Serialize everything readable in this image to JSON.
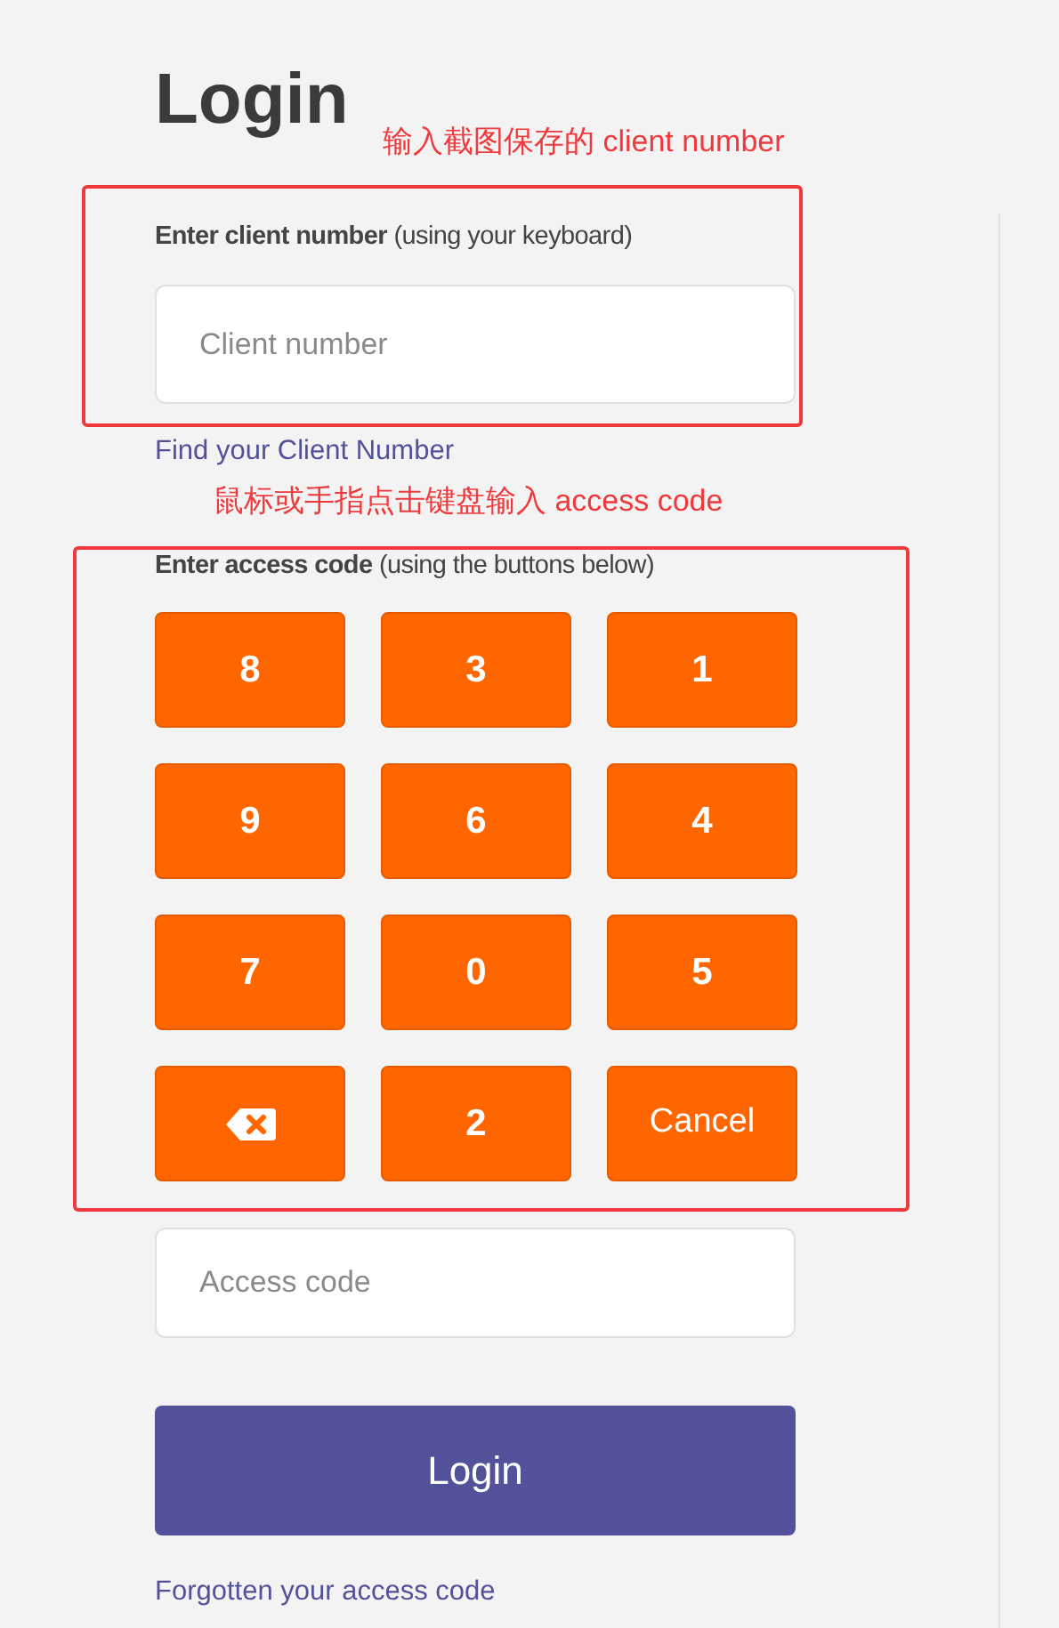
{
  "title": "Login",
  "notes": [
    {
      "text": "输入截图保存的 client number"
    },
    {
      "text": "鼠标或手指点击键盘输入 access code"
    }
  ],
  "client_number": {
    "highlighted": true,
    "label": "**Enter client number** (using your keyboard)",
    "placeholder": "Client number",
    "link": "Find your Client Number"
  },
  "access_code": {
    "highlighted": true,
    "label": "**Enter access code** (using the buttons below)",
    "keys": [
      {
        "kind": "digit",
        "label": "8"
      },
      {
        "kind": "digit",
        "label": "3"
      },
      {
        "kind": "digit",
        "label": "1"
      },
      {
        "kind": "digit",
        "label": "9"
      },
      {
        "kind": "digit",
        "label": "6"
      },
      {
        "kind": "digit",
        "label": "4"
      },
      {
        "kind": "digit",
        "label": "7"
      },
      {
        "kind": "digit",
        "label": "0"
      },
      {
        "kind": "digit",
        "label": "5"
      },
      {
        "kind": "backspace"
      },
      {
        "kind": "digit",
        "label": "2"
      },
      {
        "kind": "text",
        "label": "Cancel"
      }
    ],
    "placeholder": "Access code"
  },
  "login_button": "Login",
  "forgot_link": "Forgotten your access code"
}
